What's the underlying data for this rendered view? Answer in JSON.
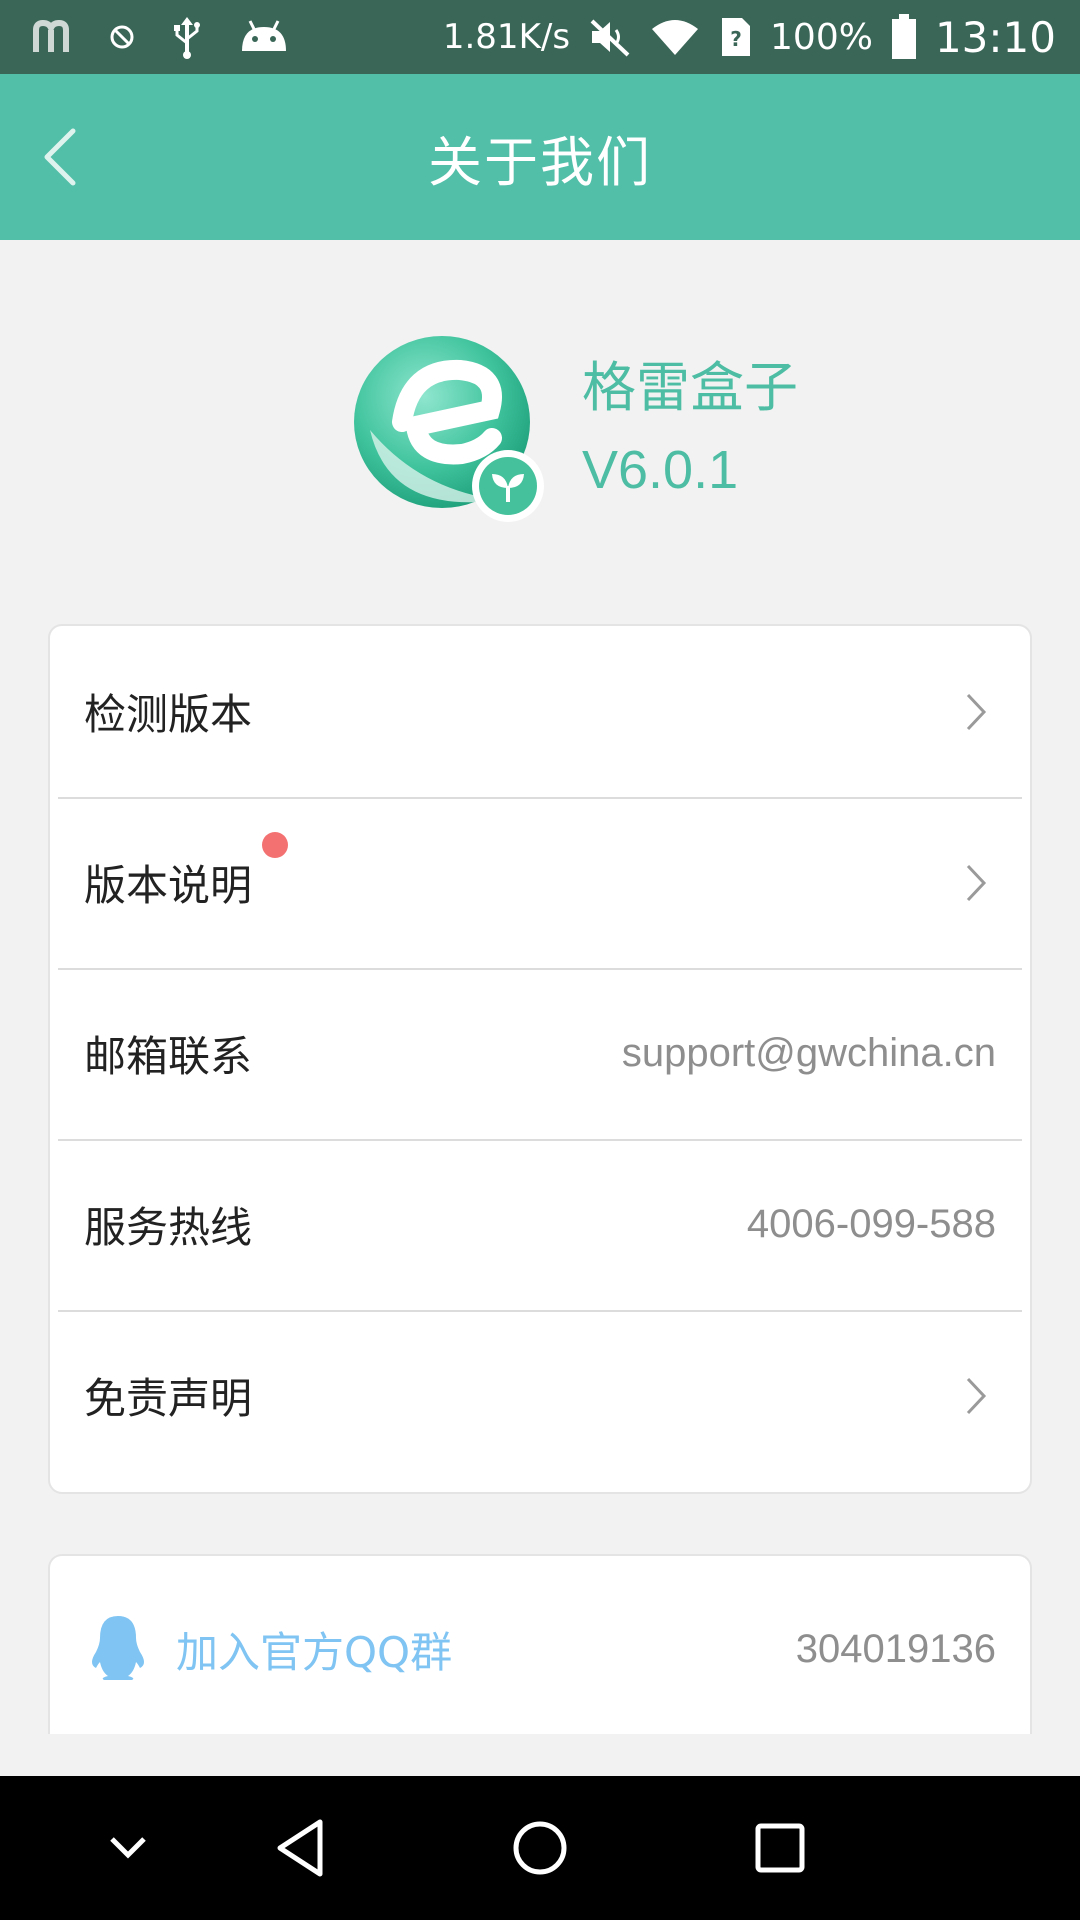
{
  "status_bar": {
    "net_speed": "1.81K/s",
    "battery": "100%",
    "time": "13:10",
    "icons": [
      "m-app-icon",
      "blocked-icon",
      "usb-icon",
      "android-icon",
      "mute-icon",
      "wifi-icon",
      "sim-icon",
      "battery-icon"
    ]
  },
  "header": {
    "title": "关于我们"
  },
  "app": {
    "name": "格雷盒子",
    "version": "V6.0.1"
  },
  "menu": {
    "items": [
      {
        "label": "检测版本",
        "value": "",
        "has_chevron": true,
        "badge": false
      },
      {
        "label": "版本说明",
        "value": "",
        "has_chevron": true,
        "badge": true
      },
      {
        "label": "邮箱联系",
        "value": "support@gwchina.cn",
        "has_chevron": false,
        "badge": false
      },
      {
        "label": "服务热线",
        "value": "4006-099-588",
        "has_chevron": false,
        "badge": false
      },
      {
        "label": "免责声明",
        "value": "",
        "has_chevron": true,
        "badge": false
      }
    ]
  },
  "qq": {
    "label": "加入官方QQ群",
    "number": "304019136"
  },
  "colors": {
    "status_bar": "#3a6658",
    "header": "#52bfa9",
    "brand_text": "#4dbda3",
    "qq_blue": "#7fc4f2",
    "badge_red": "#f47171"
  }
}
